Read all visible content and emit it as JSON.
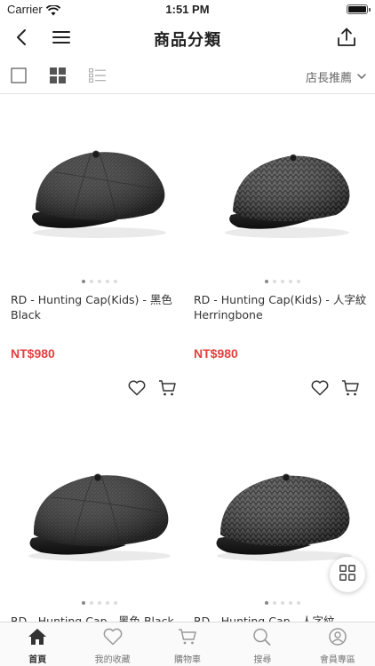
{
  "status_bar": {
    "carrier": "Carrier",
    "time": "1:51 PM"
  },
  "nav": {
    "title": "商品分類"
  },
  "toolbar": {
    "sort_label": "店長推薦"
  },
  "products": [
    {
      "name": "RD - Hunting Cap(Kids) - 黑色 Black",
      "price": "NT$980"
    },
    {
      "name": "RD - Hunting Cap(Kids) - 人字紋 Herringbone",
      "price": "NT$980"
    },
    {
      "name": "RD - Hunting Cap - 黑色 Black",
      "price": ""
    },
    {
      "name": "RD - Hunting Cap - 人字紋",
      "price": ""
    }
  ],
  "tabs": [
    {
      "label": "首頁",
      "icon": "home-icon"
    },
    {
      "label": "我的收藏",
      "icon": "heart-icon"
    },
    {
      "label": "購物車",
      "icon": "cart-icon"
    },
    {
      "label": "搜尋",
      "icon": "search-icon"
    },
    {
      "label": "會員專區",
      "icon": "user-icon"
    }
  ],
  "colors": {
    "price": "#e2403f",
    "active_tab": "#333333",
    "inactive_tab": "#999999"
  }
}
